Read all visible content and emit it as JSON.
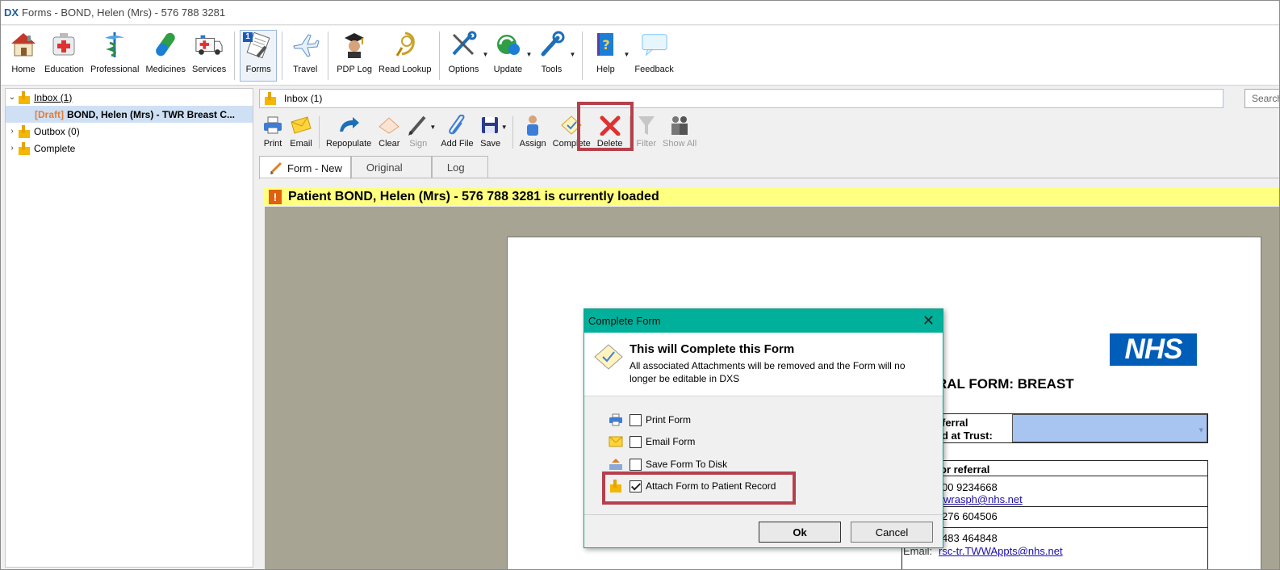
{
  "window": {
    "logo": "DX",
    "title": "Forms  -  BOND, Helen (Mrs) - 576 788 3281"
  },
  "ribbon": {
    "items": [
      {
        "label": "Home",
        "icon": "home-icon"
      },
      {
        "label": "Education",
        "icon": "education-icon"
      },
      {
        "label": "Professional",
        "icon": "professional-icon"
      },
      {
        "label": "Medicines",
        "icon": "medicines-icon"
      },
      {
        "label": "Services",
        "icon": "ambulance-icon"
      },
      {
        "label": "Forms",
        "icon": "forms-icon",
        "badge": "1",
        "active": true
      },
      {
        "label": "Travel",
        "icon": "travel-icon"
      },
      {
        "label": "PDP Log",
        "icon": "pdp-log-icon"
      },
      {
        "label": "Read Lookup",
        "icon": "read-lookup-icon"
      },
      {
        "label": "Options",
        "icon": "options-icon"
      },
      {
        "label": "Update",
        "icon": "update-icon"
      },
      {
        "label": "Tools",
        "icon": "tools-icon"
      },
      {
        "label": "Help",
        "icon": "help-icon"
      },
      {
        "label": "Feedback",
        "icon": "feedback-icon"
      }
    ]
  },
  "tree": {
    "inbox": "Inbox (1)",
    "draft_tag": "[Draft]",
    "draft_item": "BOND, Helen (Mrs) - TWR Breast C...",
    "outbox": "Outbox (0)",
    "complete": "Complete"
  },
  "inbox_bar": {
    "label": "Inbox (1)",
    "search_placeholder": "Search"
  },
  "toolbar": {
    "print": "Print",
    "email": "Email",
    "repopulate": "Repopulate",
    "clear": "Clear",
    "sign": "Sign",
    "add_file": "Add File",
    "save": "Save",
    "assign": "Assign",
    "complete": "Complete",
    "delete": "Delete",
    "filter": "Filter",
    "show_all": "Show All"
  },
  "tabs": {
    "form_new": "Form - New",
    "original": "Original",
    "log": "Log"
  },
  "alert": {
    "icon": "!",
    "text": "Patient BOND, Helen (Mrs) - 576 788 3281 is currently loaded"
  },
  "form": {
    "nhs_logo": "NHS",
    "title_fragment": "RAL FORM: BREAST",
    "referral_line1": "ferral",
    "referral_line2": "d at Trust:",
    "section_fragment": "or referral",
    "phone1": "00 9234668",
    "email1": "wrasph@nhs.net",
    "phone2": "276 604506",
    "phone3": "483 464848",
    "email_label": "Email:",
    "email2": "rsc-tr.TWWAppts@nhs.net"
  },
  "dialog": {
    "title": "Complete Form",
    "heading": "This will Complete this Form",
    "description": "All associated Attachments will be removed and the Form will no longer be editable in DXS",
    "options": {
      "print": {
        "label": "Print Form",
        "checked": false
      },
      "email": {
        "label": "Email Form",
        "checked": false
      },
      "save_disk": {
        "label": "Save Form To Disk",
        "checked": false
      },
      "attach": {
        "label": "Attach Form to Patient Record",
        "checked": true
      }
    },
    "ok": "Ok",
    "cancel": "Cancel"
  },
  "colors": {
    "accent_teal": "#00b09a",
    "highlight": "#b5404c",
    "alert_bg": "#ffff80",
    "nhs_blue": "#005eb8"
  }
}
